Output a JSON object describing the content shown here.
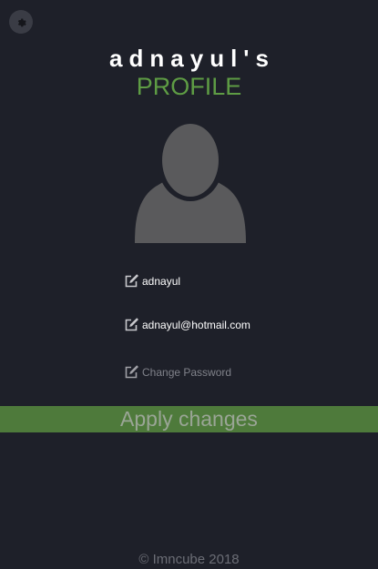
{
  "header": {
    "username_title": "adnayul's",
    "profile_label": "PROFILE"
  },
  "icons": {
    "settings": "gear-icon",
    "avatar": "user-silhouette-icon",
    "edit": "edit-pencil-icon"
  },
  "fields": {
    "username": {
      "value": "adnayul"
    },
    "email": {
      "value": "adnayul@hotmail.com"
    },
    "password": {
      "placeholder": "Change Password"
    }
  },
  "actions": {
    "apply_label": "Apply changes"
  },
  "footer": {
    "copyright": "© Imncube 2018"
  },
  "colors": {
    "background": "#1e2029",
    "accent_green": "#5e9c44",
    "apply_bar": "#4e7a3b",
    "avatar_gray": "#5a5a5c"
  }
}
